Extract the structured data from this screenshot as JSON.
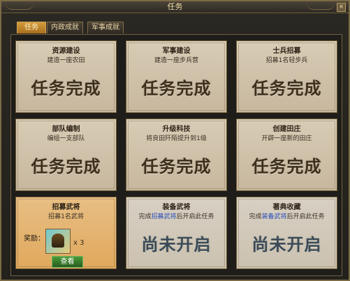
{
  "window": {
    "title": "任务",
    "close_symbol": "×"
  },
  "tabs": [
    {
      "label": "任务"
    },
    {
      "label": "内政成就"
    },
    {
      "label": "军事成就"
    }
  ],
  "cards": [
    {
      "title": "资源建设",
      "desc": "建造一座农田",
      "status": "任务完成"
    },
    {
      "title": "军事建设",
      "desc": "建造一座步兵营",
      "status": "任务完成"
    },
    {
      "title": "士兵招募",
      "desc": "招募1名轻步兵",
      "status": "任务完成"
    },
    {
      "title": "部队编制",
      "desc": "编组一支部队",
      "status": "任务完成"
    },
    {
      "title": "升级科技",
      "desc": "将良田阡陌提升到1级",
      "status": "任务完成"
    },
    {
      "title": "创建田庄",
      "desc": "开辟一座新的田庄",
      "status": "任务完成"
    },
    {
      "title": "招募武将",
      "desc": "招募1名武将",
      "reward_label": "奖励：",
      "reward_count": "x 3",
      "button_label": "查看"
    },
    {
      "title": "装备武将",
      "desc_prefix": "完成",
      "desc_link": "招募武将",
      "desc_suffix": "后开启此任务",
      "status": "尚未开启"
    },
    {
      "title": "著典收藏",
      "desc_prefix": "完成",
      "desc_link": "装备武将",
      "desc_suffix": "后开启此任务",
      "status": "尚未开启"
    }
  ]
}
